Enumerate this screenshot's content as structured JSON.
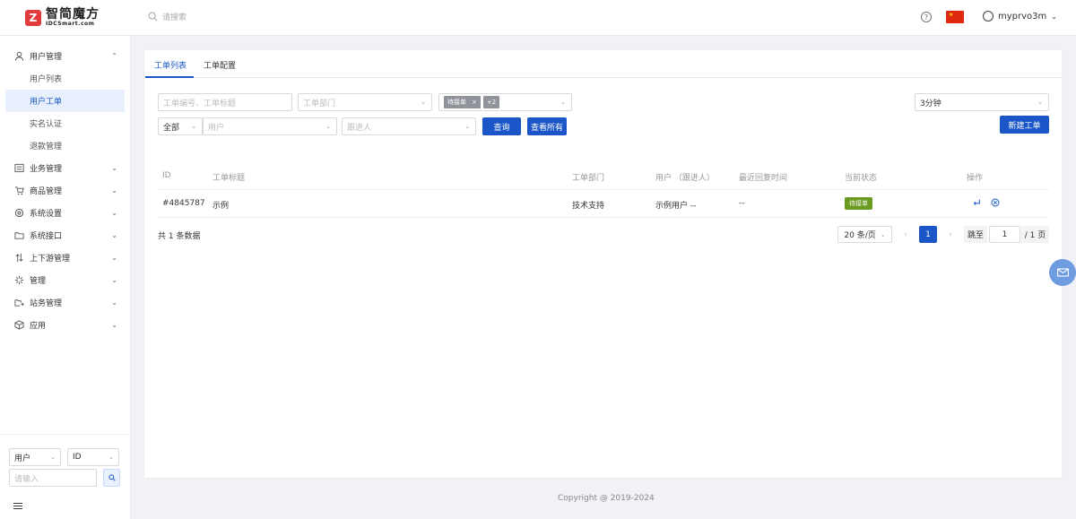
{
  "brand": {
    "name_cn": "智简魔方",
    "name_en": "IDCSmart.com",
    "logo_glyph": "Z",
    "accent": "#1a56c8",
    "logo_color": "#e23b3b"
  },
  "header": {
    "search_placeholder": "请搜索",
    "help_glyph": "?",
    "username": "myprvo3m",
    "flag_glyph": "★"
  },
  "sidebar": {
    "items": [
      {
        "label": "用户管理",
        "icon": "user-icon",
        "expanded": true
      },
      {
        "label": "用户列表",
        "sub": true
      },
      {
        "label": "用户工单",
        "sub": true,
        "active": true
      },
      {
        "label": "实名认证",
        "sub": true
      },
      {
        "label": "退款管理",
        "sub": true
      },
      {
        "label": "业务管理",
        "icon": "list-icon"
      },
      {
        "label": "商品管理",
        "icon": "cart-icon"
      },
      {
        "label": "系统设置",
        "icon": "gear-icon"
      },
      {
        "label": "系统接口",
        "icon": "folder-icon"
      },
      {
        "label": "上下游管理",
        "icon": "updown-icon"
      },
      {
        "label": "管理",
        "icon": "sparkle-icon"
      },
      {
        "label": "站务管理",
        "icon": "share-icon"
      },
      {
        "label": "应用",
        "icon": "box-icon"
      }
    ],
    "bottom": {
      "select_type": "用户",
      "select_field": "ID",
      "search_placeholder": "请输入"
    }
  },
  "tabs": [
    {
      "label": "工单列表",
      "active": true
    },
    {
      "label": "工单配置"
    }
  ],
  "filters": {
    "ticket_placeholder": "工单编号、工单标题",
    "dept_placeholder": "工单部门",
    "status_tag": "待接单",
    "status_close": "×",
    "status_more": "+2",
    "refresh": "3分钟",
    "scope": "全部",
    "user_placeholder": "用户",
    "follower_placeholder": "跟进人",
    "query_btn": "查询",
    "view_all_btn": "查看所有",
    "new_btn": "新建工单"
  },
  "table": {
    "columns": [
      "ID",
      "工单标题",
      "工单部门",
      "用户 （跟进人）",
      "最近回复时间",
      "当前状态",
      "操作"
    ],
    "rows": [
      {
        "id": "#4845787",
        "title": "示例",
        "dept": "技术支持",
        "user": "示例用户 --",
        "last_reply": "--",
        "status": "待接单",
        "status_color": "#6a9a1f"
      }
    ]
  },
  "pagination": {
    "total_text": "共 1 条数据",
    "page_size": "20 条/页",
    "prev": "‹",
    "current": "1",
    "next": "›",
    "jump_label": "跳至",
    "jump_value": "1",
    "total_pages": "/ 1 页"
  },
  "footer": {
    "copyright": "Copyright @ 2019-2024"
  }
}
